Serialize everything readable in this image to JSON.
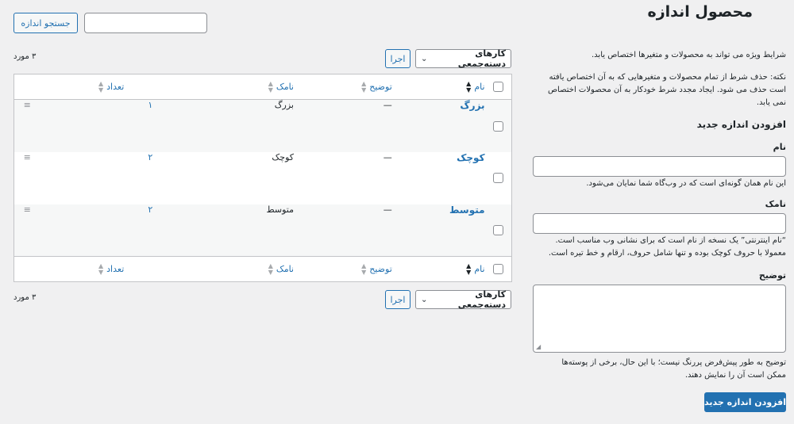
{
  "page": {
    "title": "محصول اندازه"
  },
  "search": {
    "placeholder": "",
    "button_label": "جستجو اندازه"
  },
  "bulk": {
    "top_select": "کارهای دسته‌جمعی",
    "top_apply": "اجرا",
    "bottom_select": "کارهای دسته‌جمعی",
    "bottom_apply": "اجرا"
  },
  "counts": {
    "top": "۳ مورد",
    "bottom": "۳ مورد"
  },
  "table": {
    "columns": {
      "name": "نام",
      "description": "توضیح",
      "slug": "نامک",
      "count": "تعداد"
    },
    "rows": [
      {
        "name": "بزرگ",
        "description": "—",
        "slug": "بزرگ",
        "count": "۱"
      },
      {
        "name": "کوچک",
        "description": "—",
        "slug": "کوچک",
        "count": "۲"
      },
      {
        "name": "متوسط",
        "description": "—",
        "slug": "متوسط",
        "count": "۲"
      }
    ]
  },
  "intro": {
    "text": "شرایط ویژه می تواند به محصولات و متغیرها اختصاص یابد.",
    "note_line1": "نکته: حذف شرط از تمام محصولات و متغیرهایی که به آن اختصاص یافته",
    "note_line2": "است حذف می شود. ایجاد مجدد شرط خودکار به آن محصولات اختصاص",
    "note_line3": "نمی یابد."
  },
  "form": {
    "heading": "افزودن اندازه جدید",
    "name_label": "نام",
    "name_value": "",
    "name_help": "این نام همان گونه‌ای است که در وب‌گاه شما نمایان می‌شود.",
    "slug_label": "نامک",
    "slug_value": "",
    "slug_help_line1": "“نام اینترنتی” یک نسخه از نام است که برای نشانی وب مناسب است.",
    "slug_help_line2": "معمولا با حروف کوچک بوده و تنها شامل حروف، ارقام و خط تیره است.",
    "desc_label": "توضیح",
    "desc_value": "",
    "desc_help_line1": "توضیح به طور پیش‌فرض پررنگ نیست؛ با این حال، برخی از پوسته‌ها",
    "desc_help_line2": "ممکن است آن را نمایش دهند.",
    "submit_label": "افزودن اندازه جدید"
  },
  "icons": {
    "sort": "sort-arrows-icon",
    "chevron": "chevron-down-icon",
    "handle": "drag-handle-icon",
    "resize": "resize-grip-icon"
  },
  "colors": {
    "accent": "#2271b1",
    "background": "#f0f0f1"
  }
}
